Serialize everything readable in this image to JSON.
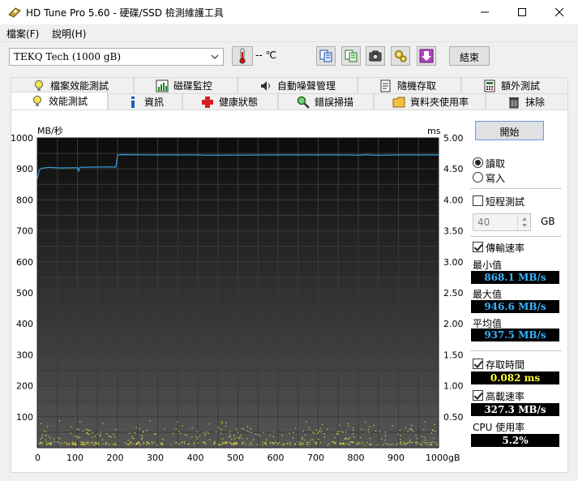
{
  "window": {
    "title": "HD Tune Pro 5.60 - 硬碟/SSD 檢測維護工具"
  },
  "menu": {
    "file": "檔案(F)",
    "help": "說明(H)"
  },
  "toolbar": {
    "drive": "TEKQ    Tech (1000 gB)",
    "temperature": "-- ℃",
    "exit_label": "結束"
  },
  "tabs": {
    "top": [
      "檔案效能測試",
      "磁碟監控",
      "自動噪聲管理",
      "隨機存取",
      "額外測試"
    ],
    "bottom": [
      "效能測試",
      "資訊",
      "健康狀態",
      "錯誤掃描",
      "資料夾使用率",
      "抹除"
    ]
  },
  "controls": {
    "start_label": "開始",
    "read_label": "讀取",
    "write_label": "寫入",
    "short_test_label": "短程測試",
    "size_value": "40",
    "size_unit": "GB",
    "transfer_rate_label": "傳輸速率",
    "min_label": "最小值",
    "min_value": "868.1 MB/s",
    "max_label": "最大值",
    "max_value": "946.6 MB/s",
    "avg_label": "平均值",
    "avg_value": "937.5 MB/s",
    "access_time_label": "存取時間",
    "access_time_value": "0.082 ms",
    "burst_label": "高載速率",
    "burst_value": "327.3 MB/s",
    "cpu_label": "CPU 使用率",
    "cpu_value": "5.2%"
  },
  "colors": {
    "transfer_line": "#3aa0d8",
    "access_points": "#e0e040",
    "grid": "#3a3a3a"
  },
  "chart_data": {
    "type": "line",
    "ylabel": "MB/秒",
    "y2label": "ms",
    "ylim": [
      0,
      1000
    ],
    "y2lim": [
      0,
      5
    ],
    "xlim": [
      0,
      1000
    ],
    "x_unit": "gB",
    "yticks": [
      100,
      200,
      300,
      400,
      500,
      600,
      700,
      800,
      900,
      1000
    ],
    "y2ticks": [
      "0.50",
      "1.00",
      "1.50",
      "2.00",
      "2.50",
      "3.00",
      "3.50",
      "4.00",
      "4.50",
      "5.00"
    ],
    "xticks": [
      "0",
      "100",
      "200",
      "300",
      "400",
      "500",
      "600",
      "700",
      "800",
      "900",
      "1000gB"
    ],
    "series": [
      {
        "name": "傳輸速率",
        "x": [
          0,
          5,
          10,
          30,
          60,
          100,
          103,
          106,
          110,
          150,
          196,
          200,
          210,
          300,
          400,
          420,
          600,
          700,
          780,
          800,
          820,
          840,
          900,
          1000
        ],
        "y": [
          868,
          895,
          902,
          905,
          903,
          904,
          893,
          905,
          905,
          906,
          906,
          945,
          946,
          945,
          945,
          944,
          945,
          945,
          945,
          944,
          946,
          944,
          945,
          945
        ]
      }
    ]
  }
}
